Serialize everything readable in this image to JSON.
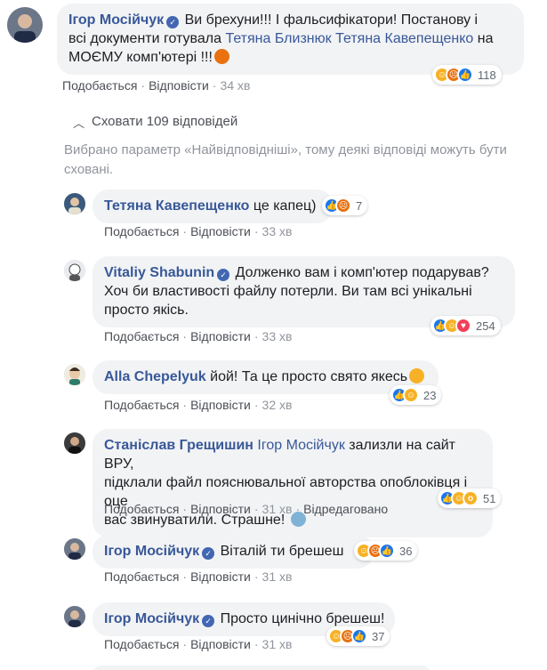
{
  "main_comment": {
    "author": "Ігор Мосійчук",
    "text_1": "Ви брехуни!!! І фальсифікатори! Постанову і",
    "text_2a": "всі документи готувала ",
    "tag_1": "Тетяна Близнюк",
    "tag_2": "Тетяна Кавепещенко",
    "text_2b": " на",
    "text_3": "МОЄМУ комп'ютері !!!",
    "like": "Подобається",
    "reply": "Відповісти",
    "time": "34 хв",
    "reaction_count": "118"
  },
  "replies_toggle": {
    "chevron": "^",
    "label": "Сховати 109 відповідей"
  },
  "filter_note": "Вибрано параметр «Найвідповідніші», тому деякі відповіді можуть бути сховані.",
  "replies": [
    {
      "author": "Тетяна Кавепещенко",
      "text": "це капец)",
      "like": "Подобається",
      "reply": "Відповісти",
      "time": "33 хв",
      "reaction_count": "7"
    },
    {
      "author": "Vitaliy Shabunin",
      "text_1": "Долженко вам і комп'ютер подарував?",
      "text_2": "Хоч би властивості файлу потерли. Ви там всі унікальні",
      "text_3": "просто якісь.",
      "like": "Подобається",
      "reply": "Відповісти",
      "time": "33 хв",
      "reaction_count": "254"
    },
    {
      "author": "Alla Chepelyuk",
      "text": "йой! Та це просто свято якесь",
      "like": "Подобається",
      "reply": "Відповісти",
      "time": "32 хв",
      "reaction_count": "23"
    },
    {
      "author": "Станіслав Грещишин",
      "tag": "Ігор Мосійчук",
      "text_1": " зализли на сайт ВРУ,",
      "text_2": "підклали файл пояснювальної авторства опоблоківця і оце",
      "text_3": "вас звинуватили. Страшне!",
      "like": "Подобається",
      "reply": "Відповісти",
      "time": "31 хв",
      "edited": "Відредаговано",
      "reaction_count": "51"
    },
    {
      "author": "Ігор Мосійчук",
      "text": "Віталій ти брешеш",
      "like": "Подобається",
      "reply": "Відповісти",
      "time": "31 хв",
      "reaction_count": "36"
    },
    {
      "author": "Ігор Мосійчук",
      "text": "Просто цинічно брешеш!",
      "like": "Подобається",
      "reply": "Відповісти",
      "time": "31 хв",
      "reaction_count": "37"
    }
  ],
  "icons": {
    "verified": "verified-badge-icon",
    "haha": "haha-reaction-icon",
    "angry": "angry-reaction-icon",
    "like": "like-reaction-icon",
    "love": "love-reaction-icon",
    "wow": "wow-reaction-icon"
  },
  "colors": {
    "link": "#385898",
    "bubble": "#f2f3f5",
    "meta": "#90949c"
  }
}
